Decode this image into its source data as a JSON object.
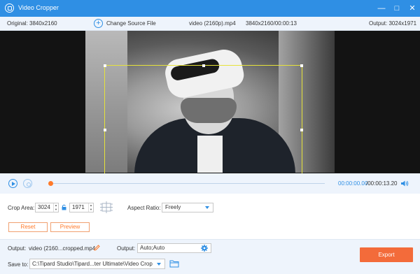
{
  "window": {
    "title": "Video Cropper"
  },
  "infobar": {
    "original": "Original: 3840x2160",
    "change_source": "Change Source File",
    "filename": "video (2160p).mp4",
    "resolution_time": "3840x2160/00:00:13",
    "output": "Output: 3024x1971"
  },
  "player": {
    "current_time": "00:00:00.00",
    "total_time": "/00:00:13.20",
    "progress_percent": 0
  },
  "crop": {
    "area_label": "Crop Area:",
    "width": "3024",
    "height": "1971",
    "aspect_label": "Aspect Ratio:",
    "aspect_value": "Freely",
    "reset_label": "Reset",
    "preview_label": "Preview"
  },
  "output": {
    "output_label": "Output:",
    "filename": "video (2160...cropped.mp4",
    "format_label": "Output:",
    "format_value": "Auto;Auto",
    "save_label": "Save to:",
    "save_path": "C:\\Tipard Studio\\Tipard...ter Ultimate\\Video Crop",
    "export_label": "Export"
  },
  "colors": {
    "accent": "#2f8fe4",
    "export": "#f36b3a",
    "crop_border": "#e6e23a"
  }
}
